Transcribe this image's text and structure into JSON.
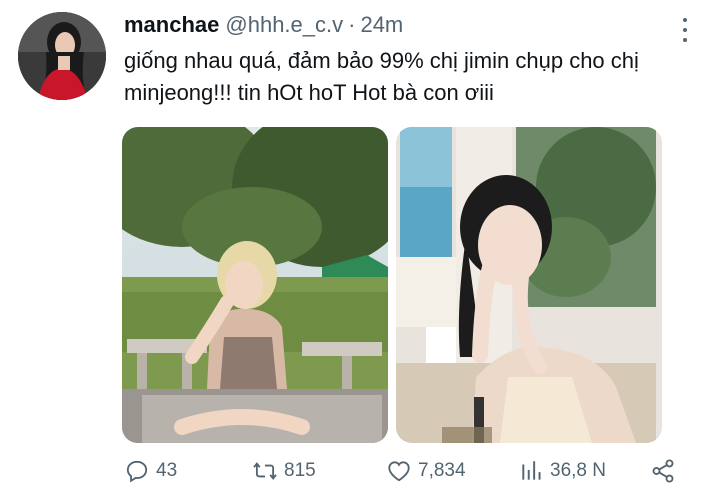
{
  "tweet": {
    "display_name": "manchae",
    "handle": "@hhh.e_c.v",
    "separator": "·",
    "time": "24m",
    "text": "giống nhau quá, đảm bảo 99% chị jimin chụp cho chị minjeong!!! tin hOt hoT Hot bà con ơiii"
  },
  "stats": {
    "replies": "43",
    "retweets": "815",
    "likes": "7,834",
    "views": "36,8 N"
  },
  "icons": {
    "avatar": "profile-avatar",
    "more": "more-options-icon",
    "reply": "reply-icon",
    "retweet": "retweet-icon",
    "like": "heart-icon",
    "views": "views-chart-icon",
    "share": "share-icon"
  },
  "colors": {
    "text": "#0f1419",
    "secondary": "#536471"
  }
}
